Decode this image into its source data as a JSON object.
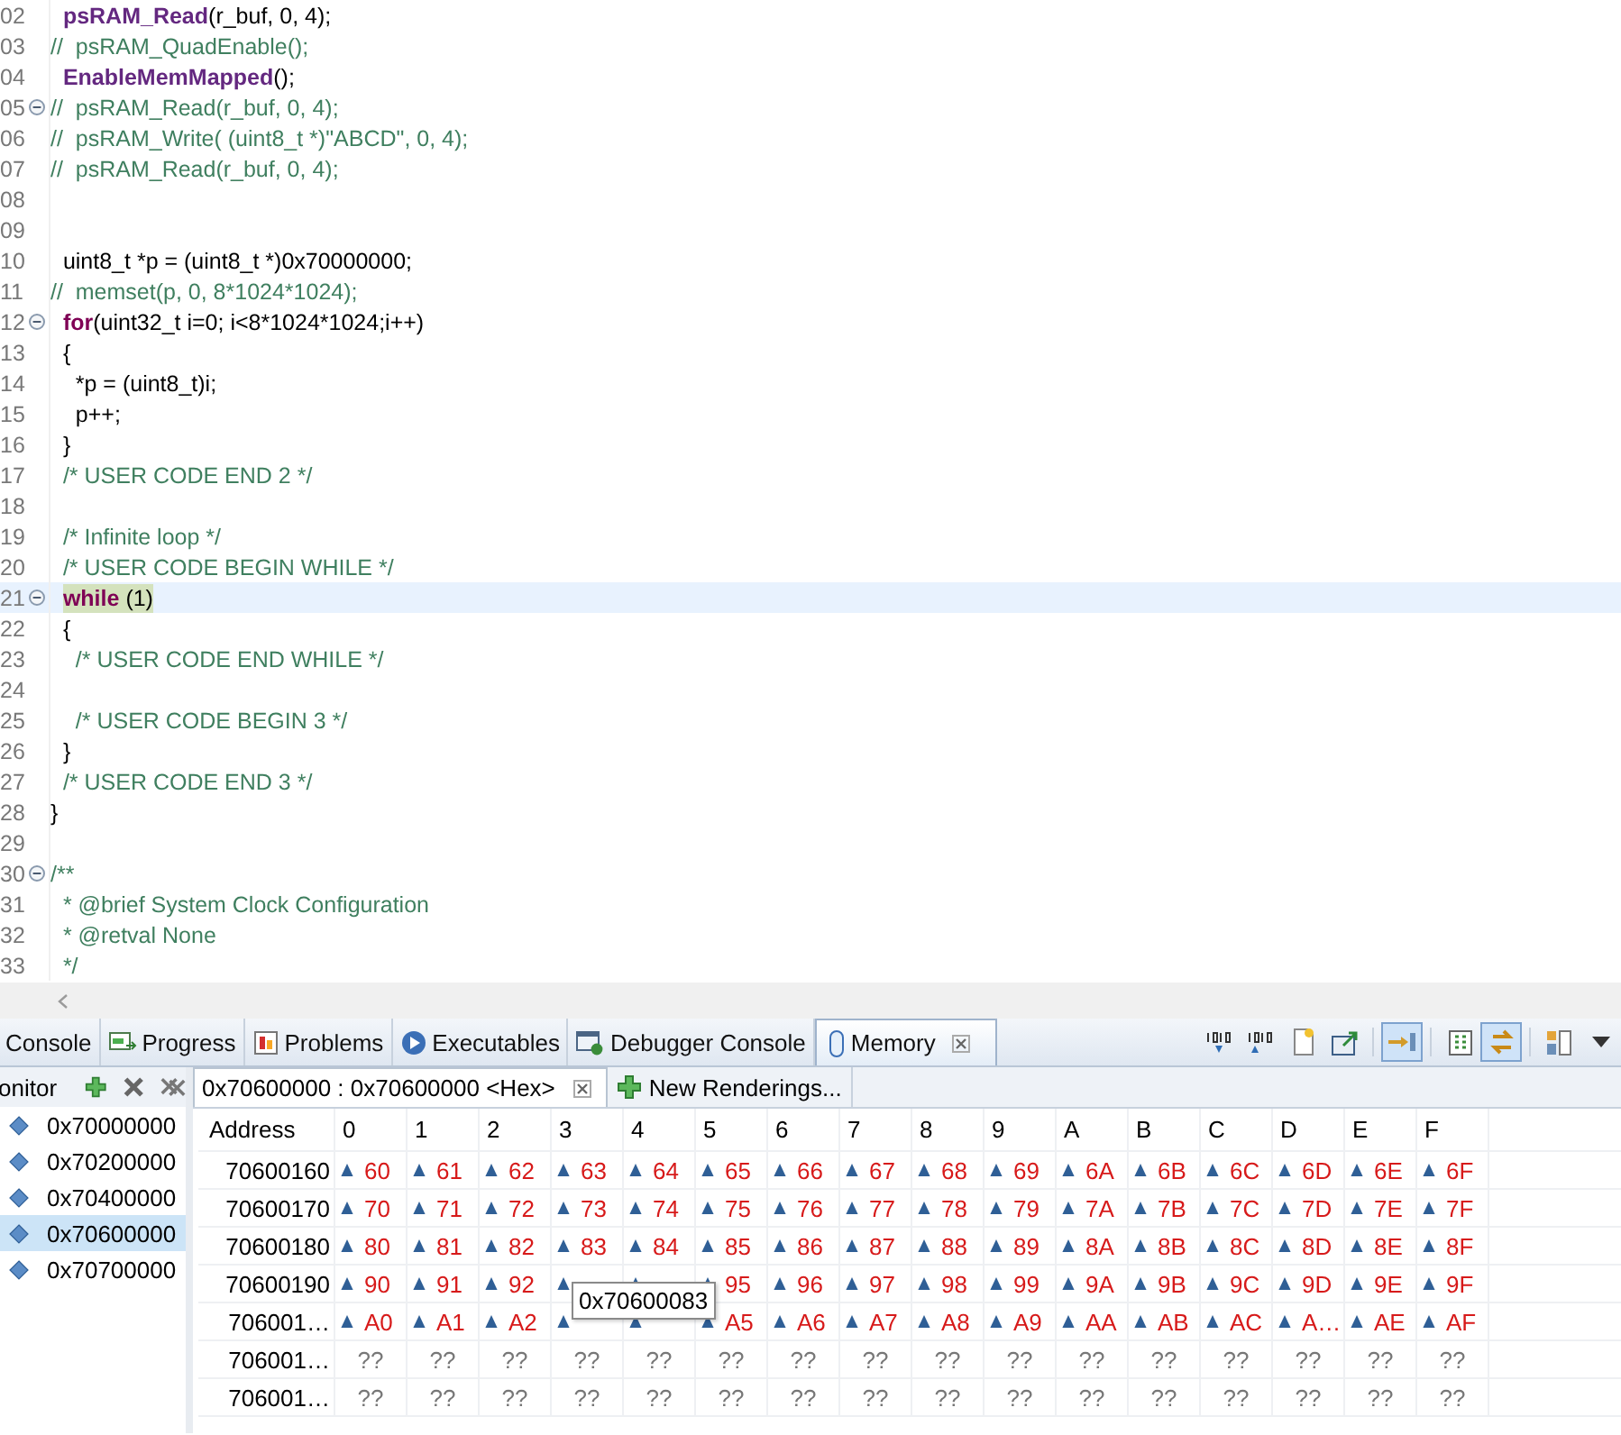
{
  "editor": {
    "lines": [
      {
        "number": "02",
        "fold": false,
        "highlight": false,
        "segments": [
          {
            "kind": "func",
            "text": "  psRAM_Read"
          },
          {
            "kind": "plain",
            "text": "(r_buf, 0, 4);"
          }
        ]
      },
      {
        "number": "03",
        "fold": false,
        "highlight": false,
        "segments": [
          {
            "kind": "comment",
            "text": "//  psRAM_QuadEnable();"
          }
        ]
      },
      {
        "number": "04",
        "fold": false,
        "highlight": false,
        "segments": [
          {
            "kind": "func",
            "text": "  EnableMemMapped"
          },
          {
            "kind": "plain",
            "text": "();"
          }
        ]
      },
      {
        "number": "05",
        "fold": true,
        "highlight": false,
        "segments": [
          {
            "kind": "comment",
            "text": "//  psRAM_Read(r_buf, 0, 4);"
          }
        ]
      },
      {
        "number": "06",
        "fold": false,
        "highlight": false,
        "segments": [
          {
            "kind": "comment",
            "text": "//  psRAM_Write( (uint8_t *)\"ABCD\", 0, 4);"
          }
        ]
      },
      {
        "number": "07",
        "fold": false,
        "highlight": false,
        "segments": [
          {
            "kind": "comment",
            "text": "//  psRAM_Read(r_buf, 0, 4);"
          }
        ]
      },
      {
        "number": "08",
        "fold": false,
        "highlight": false
      },
      {
        "number": "09",
        "fold": false,
        "highlight": false
      },
      {
        "number": "10",
        "fold": false,
        "highlight": false,
        "segments": [
          {
            "kind": "plain",
            "text": "  uint8_t *p = (uint8_t *)0x70000000;"
          }
        ]
      },
      {
        "number": "11",
        "fold": false,
        "highlight": false,
        "segments": [
          {
            "kind": "comment",
            "text": "//  memset(p, 0, 8*1024*1024);"
          }
        ]
      },
      {
        "number": "12",
        "fold": true,
        "highlight": false,
        "segments": [
          {
            "kind": "keyword",
            "text": "  for"
          },
          {
            "kind": "plain",
            "text": "(uint32_t i=0; i<8*1024*1024;i++)"
          }
        ]
      },
      {
        "number": "13",
        "fold": false,
        "highlight": false,
        "segments": [
          {
            "kind": "plain",
            "text": "  {"
          }
        ]
      },
      {
        "number": "14",
        "fold": false,
        "highlight": false,
        "segments": [
          {
            "kind": "plain",
            "text": "    *p = (uint8_t)i;"
          }
        ]
      },
      {
        "number": "15",
        "fold": false,
        "highlight": false,
        "segments": [
          {
            "kind": "plain",
            "text": "    p++;"
          }
        ]
      },
      {
        "number": "16",
        "fold": false,
        "highlight": false,
        "segments": [
          {
            "kind": "plain",
            "text": "  }"
          }
        ]
      },
      {
        "number": "17",
        "fold": false,
        "highlight": false,
        "segments": [
          {
            "kind": "comment",
            "text": "  /* USER CODE END 2 */"
          }
        ]
      },
      {
        "number": "18",
        "fold": false,
        "highlight": false
      },
      {
        "number": "19",
        "fold": false,
        "highlight": false,
        "segments": [
          {
            "kind": "comment",
            "text": "  /* Infinite loop */"
          }
        ]
      },
      {
        "number": "20",
        "fold": false,
        "highlight": false,
        "segments": [
          {
            "kind": "comment",
            "text": "  /* USER CODE BEGIN WHILE */"
          }
        ]
      },
      {
        "number": "21",
        "fold": true,
        "highlight": true,
        "segments": [
          {
            "kind": "keyword",
            "text": "  while"
          },
          {
            "kind": "plain",
            "text": " (1)"
          }
        ]
      },
      {
        "number": "22",
        "fold": false,
        "highlight": false,
        "segments": [
          {
            "kind": "plain",
            "text": "  {"
          }
        ]
      },
      {
        "number": "23",
        "fold": false,
        "highlight": false,
        "segments": [
          {
            "kind": "comment",
            "text": "    /* USER CODE END WHILE */"
          }
        ]
      },
      {
        "number": "24",
        "fold": false,
        "highlight": false
      },
      {
        "number": "25",
        "fold": false,
        "highlight": false,
        "segments": [
          {
            "kind": "comment",
            "text": "    /* USER CODE BEGIN 3 */"
          }
        ]
      },
      {
        "number": "26",
        "fold": false,
        "highlight": false,
        "segments": [
          {
            "kind": "plain",
            "text": "  }"
          }
        ]
      },
      {
        "number": "27",
        "fold": false,
        "highlight": false,
        "segments": [
          {
            "kind": "comment",
            "text": "  /* USER CODE END 3 */"
          }
        ]
      },
      {
        "number": "28",
        "fold": false,
        "highlight": false,
        "segments": [
          {
            "kind": "plain",
            "text": "}"
          }
        ]
      },
      {
        "number": "29",
        "fold": false,
        "highlight": false
      },
      {
        "number": "30",
        "fold": true,
        "highlight": false,
        "segments": [
          {
            "kind": "comment",
            "text": "/**"
          }
        ]
      },
      {
        "number": "31",
        "fold": false,
        "highlight": false,
        "segments": [
          {
            "kind": "comment",
            "text": "  * @brief System Clock Configuration"
          }
        ]
      },
      {
        "number": "32",
        "fold": false,
        "highlight": false,
        "segments": [
          {
            "kind": "comment",
            "text": "  * @retval None"
          }
        ]
      },
      {
        "number": "33",
        "fold": false,
        "highlight": false,
        "segments": [
          {
            "kind": "comment",
            "text": "  */"
          }
        ]
      }
    ]
  },
  "view_tabs": [
    {
      "label": "Console",
      "kind": "console",
      "selected": false
    },
    {
      "label": "Progress",
      "kind": "progress",
      "selected": false
    },
    {
      "label": "Problems",
      "kind": "problems",
      "selected": false
    },
    {
      "label": "Executables",
      "kind": "executables",
      "selected": false
    },
    {
      "label": "Debugger Console",
      "kind": "debugger",
      "selected": false
    },
    {
      "label": "Memory",
      "kind": "memory",
      "selected": true
    }
  ],
  "toolbar": [
    {
      "kind": "binary",
      "selected": false
    },
    {
      "kind": "binary-alt",
      "selected": false
    },
    {
      "kind": "new-doc",
      "selected": false
    },
    {
      "kind": "export",
      "selected": false
    },
    {
      "kind": "sep"
    },
    {
      "kind": "link",
      "selected": true
    },
    {
      "kind": "sep"
    },
    {
      "kind": "columns",
      "selected": false
    },
    {
      "kind": "swap",
      "selected": true
    },
    {
      "kind": "sep"
    },
    {
      "kind": "layout",
      "selected": false
    },
    {
      "kind": "menu",
      "selected": false
    }
  ],
  "monitors": {
    "title": "onitor",
    "items": [
      {
        "address": "0x70000000",
        "selected": false
      },
      {
        "address": "0x70200000",
        "selected": false
      },
      {
        "address": "0x70400000",
        "selected": false
      },
      {
        "address": "0x70600000",
        "selected": true
      },
      {
        "address": "0x70700000",
        "selected": false
      }
    ]
  },
  "rendering_tabs": [
    {
      "label": "0x70600000 : 0x70600000 <Hex>",
      "kind": "rendering",
      "selected": true
    },
    {
      "label": "New Renderings...",
      "kind": "new",
      "selected": false
    }
  ],
  "memory_table": {
    "columns": [
      "Address",
      "0",
      "1",
      "2",
      "3",
      "4",
      "5",
      "6",
      "7",
      "8",
      "9",
      "A",
      "B",
      "C",
      "D",
      "E",
      "F"
    ],
    "rows": [
      {
        "address": "70600160",
        "changed": true,
        "cells": [
          "60",
          "61",
          "62",
          "63",
          "64",
          "65",
          "66",
          "67",
          "68",
          "69",
          "6A",
          "6B",
          "6C",
          "6D",
          "6E",
          "6F"
        ]
      },
      {
        "address": "70600170",
        "changed": true,
        "cells": [
          "70",
          "71",
          "72",
          "73",
          "74",
          "75",
          "76",
          "77",
          "78",
          "79",
          "7A",
          "7B",
          "7C",
          "7D",
          "7E",
          "7F"
        ]
      },
      {
        "address": "70600180",
        "changed": true,
        "cells": [
          "80",
          "81",
          "82",
          "83",
          "84",
          "85",
          "86",
          "87",
          "88",
          "89",
          "8A",
          "8B",
          "8C",
          "8D",
          "8E",
          "8F"
        ]
      },
      {
        "address": "70600190",
        "changed": true,
        "cells": [
          "90",
          "91",
          "92",
          null,
          null,
          "95",
          "96",
          "97",
          "98",
          "99",
          "9A",
          "9B",
          "9C",
          "9D",
          "9E",
          "9F"
        ]
      },
      {
        "address": "706001…",
        "changed": true,
        "cells": [
          "A0",
          "A1",
          "A2",
          null,
          null,
          "A5",
          "A6",
          "A7",
          "A8",
          "A9",
          "AA",
          "AB",
          "AC",
          "A…",
          "AE",
          "AF"
        ]
      },
      {
        "address": "706001…",
        "changed": false,
        "cells": [
          "??",
          "??",
          "??",
          "??",
          "??",
          "??",
          "??",
          "??",
          "??",
          "??",
          "??",
          "??",
          "??",
          "??",
          "??",
          "??"
        ]
      },
      {
        "address": "706001…",
        "changed": false,
        "cells": [
          "??",
          "??",
          "??",
          "??",
          "??",
          "??",
          "??",
          "??",
          "??",
          "??",
          "??",
          "??",
          "??",
          "??",
          "??",
          "??"
        ]
      }
    ]
  },
  "tooltip": {
    "text": "0x70600083"
  }
}
